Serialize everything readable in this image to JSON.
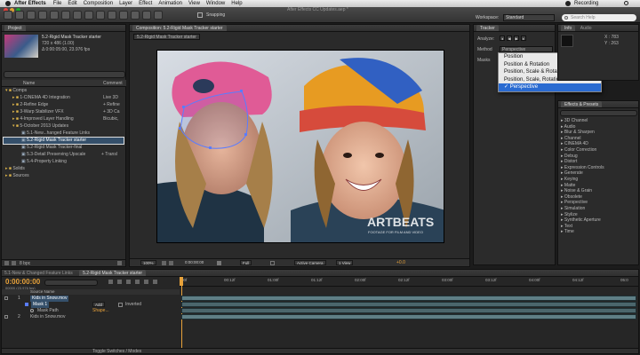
{
  "menubar": {
    "app": "After Effects",
    "items": [
      "File",
      "Edit",
      "Composition",
      "Layer",
      "Effect",
      "Animation",
      "View",
      "Window",
      "Help"
    ],
    "recording": "Recording"
  },
  "toolbar": {
    "snapping": "Snapping",
    "window_title": "After Effects CC Updates.aep *",
    "workspace_label": "Workspace:",
    "workspace_value": "Standard",
    "search_placeholder": "Search Help"
  },
  "project": {
    "tab": "Project",
    "item_name": "5.2-Rigid Mask Tracker starter",
    "item_size": "720 x 486 (1.00)",
    "item_duration": "Δ 0:00:05:00, 23.976 fps",
    "col_name": "Name",
    "col_comment": "Comment",
    "folders": [
      {
        "label": "Comps",
        "comment": ""
      },
      {
        "label": "1-CINEMA 4D Integration",
        "comment": "Live 3D"
      },
      {
        "label": "2-Refine Edge",
        "comment": "+ Refine"
      },
      {
        "label": "3-Warp Stabilizer VFX",
        "comment": "+ 3D Ca"
      },
      {
        "label": "4-Improved Layer Handling",
        "comment": "Bicubic,"
      },
      {
        "label": "5-October 2013 Updates",
        "comment": ""
      },
      {
        "label": "5.1-New...hanged Feature Links",
        "comment": ""
      },
      {
        "label": "5.2-Rigid Mask Tracker starter",
        "comment": ""
      },
      {
        "label": "5.2-Rigid Mask Tracker-final",
        "comment": ""
      },
      {
        "label": "5.3-Detail Preserving Upscale",
        "comment": "+ Transl"
      },
      {
        "label": "5.4-Property Linking",
        "comment": ""
      },
      {
        "label": "Solids",
        "comment": ""
      },
      {
        "label": "Sources",
        "comment": ""
      }
    ],
    "bpc": "8 bpc"
  },
  "comp": {
    "header": "Composition: 5.2-Rigid Mask Tracker starter",
    "tab": "5.2-Rigid Mask Tracker starter",
    "watermark": "ARTBEATS",
    "watermark_sub": "FOOTAGE FOR FILM AND VIDEO",
    "zoom": "100%",
    "timecode": "0:00:00:00",
    "resolution": "Full",
    "camera": "Active Camera",
    "views": "1 View",
    "exposure": "+0.0"
  },
  "tracker": {
    "tab": "Tracker",
    "analyze_label": "Analyze:",
    "method_label": "Method",
    "method_value": "Perspective",
    "masks_label": "Masks",
    "options": [
      "Position",
      "Position & Rotation",
      "Position, Scale & Rotation",
      "Position, Scale, Rotation & Skew",
      "✓ Perspective"
    ]
  },
  "info": {
    "tab": "Info",
    "tab2": "Audio",
    "x": "X : 783",
    "y": "Y : 263"
  },
  "effects": {
    "tab": "Effects & Presets",
    "categories": [
      "3D Channel",
      "Audio",
      "Blur & Sharpen",
      "Channel",
      "CINEMA 4D",
      "Color Correction",
      "Debug",
      "Distort",
      "Expression Controls",
      "Generate",
      "Keying",
      "Matte",
      "Noise & Grain",
      "Obsolete",
      "Perspective",
      "Simulation",
      "Stylize",
      "Synthetic Aperture",
      "Text",
      "Time"
    ]
  },
  "timeline": {
    "tab1": "5.1-New & Changed Feature Links",
    "tab2": "5.2-Rigid Mask Tracker starter",
    "timecode": "0:00:00:00",
    "frame_info": "00000 (23.976 fps)",
    "col_source": "Source Name",
    "ticks": [
      "00f",
      "00:12f",
      "01:00f",
      "01:12f",
      "02:00f",
      "02:12f",
      "03:00f",
      "03:12f",
      "04:00f",
      "04:12f",
      "05:0"
    ],
    "layers": [
      {
        "num": "1",
        "name": "Kids in Snow.mov"
      },
      {
        "num": "",
        "name": "Mask 1"
      },
      {
        "num": "",
        "name": "Mask Path"
      },
      {
        "num": "2",
        "name": "Kids in Snow.mov"
      }
    ],
    "mask_mode": "Add",
    "mask_inverted": "Inverted",
    "mask_shape": "Shape...",
    "footer": "Toggle Switches / Modes"
  },
  "colors": {
    "accent": "#e8a23a",
    "selection": "#35506b",
    "dropdown_sel": "#2a6bd1",
    "layer_bar": "#5f7f86",
    "mask_outline": "#5a7cff"
  }
}
